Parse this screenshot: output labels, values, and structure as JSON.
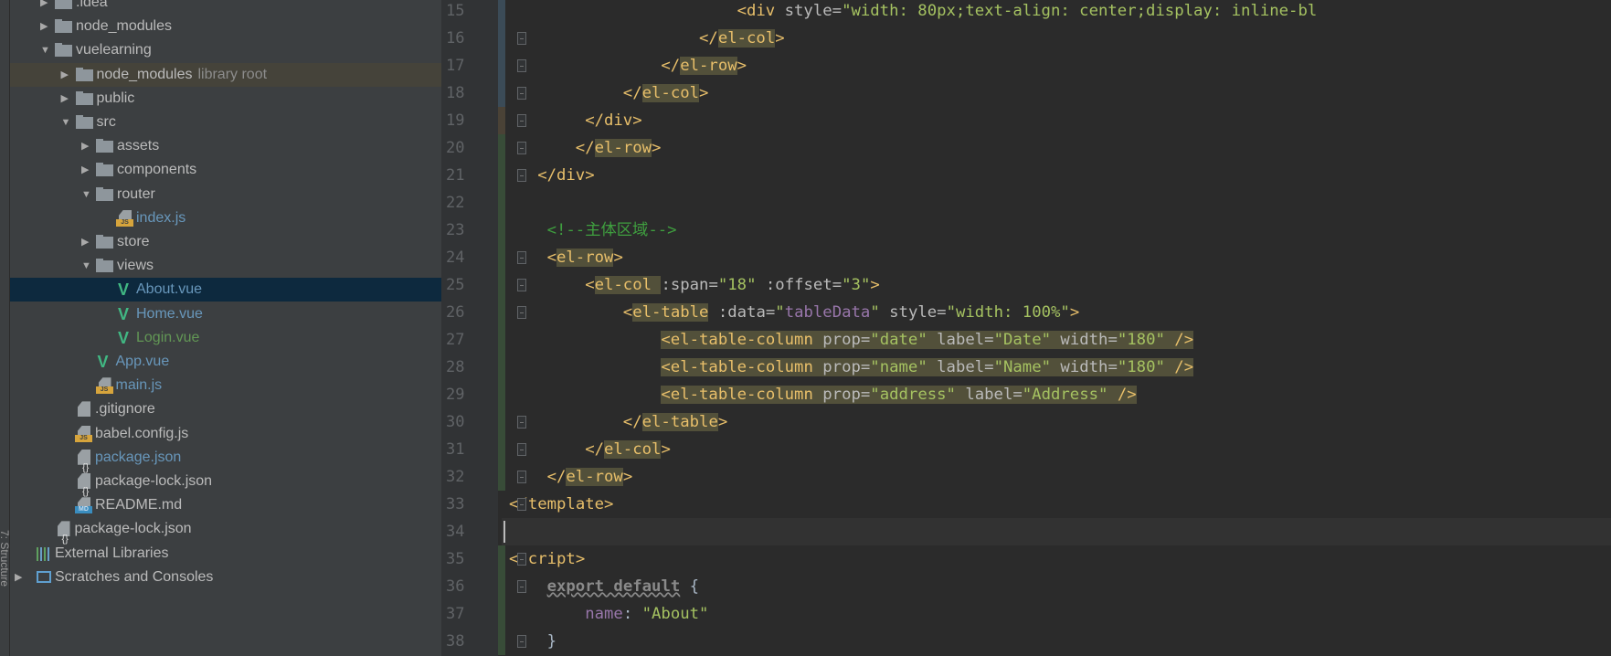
{
  "toolstrip": {
    "structure_label": "7: Structure"
  },
  "project_tree": [
    {
      "label": ".idea",
      "level": 0,
      "kind": "folder",
      "expanded": false
    },
    {
      "label": "node_modules",
      "level": 0,
      "kind": "folder",
      "expanded": false
    },
    {
      "label": "vuelearning",
      "level": 0,
      "kind": "folder",
      "expanded": true
    },
    {
      "label": "node_modules",
      "suffix": "library root",
      "level": 1,
      "kind": "folder",
      "expanded": false,
      "state": "library"
    },
    {
      "label": "public",
      "level": 1,
      "kind": "folder",
      "expanded": false
    },
    {
      "label": "src",
      "level": 1,
      "kind": "folder",
      "expanded": true
    },
    {
      "label": "assets",
      "level": 2,
      "kind": "folder",
      "expanded": false
    },
    {
      "label": "components",
      "level": 2,
      "kind": "folder",
      "expanded": false
    },
    {
      "label": "router",
      "level": 2,
      "kind": "folder",
      "expanded": true
    },
    {
      "label": "index.js",
      "level": 3,
      "kind": "js",
      "color": "#6897bb"
    },
    {
      "label": "store",
      "level": 2,
      "kind": "folder",
      "expanded": false
    },
    {
      "label": "views",
      "level": 2,
      "kind": "folder",
      "expanded": true
    },
    {
      "label": "About.vue",
      "level": 3,
      "kind": "vue",
      "color": "#6897bb",
      "state": "selected"
    },
    {
      "label": "Home.vue",
      "level": 3,
      "kind": "vue",
      "color": "#6897bb"
    },
    {
      "label": "Login.vue",
      "level": 3,
      "kind": "vue",
      "color": "#629755"
    },
    {
      "label": "App.vue",
      "level": 2,
      "kind": "vue",
      "color": "#6897bb"
    },
    {
      "label": "main.js",
      "level": 2,
      "kind": "js",
      "color": "#6897bb"
    },
    {
      "label": ".gitignore",
      "level": 1,
      "kind": "text"
    },
    {
      "label": "babel.config.js",
      "level": 1,
      "kind": "js"
    },
    {
      "label": "package.json",
      "level": 1,
      "kind": "json",
      "color": "#6897bb"
    },
    {
      "label": "package-lock.json",
      "level": 1,
      "kind": "json"
    },
    {
      "label": "README.md",
      "level": 1,
      "kind": "md"
    },
    {
      "label": "package-lock.json",
      "level": 0,
      "kind": "json"
    },
    {
      "label": "External Libraries",
      "level": -1,
      "kind": "libs"
    },
    {
      "label": "Scratches and Consoles",
      "level": -1,
      "kind": "scratches",
      "expanded": false
    }
  ],
  "editor": {
    "current_line": 34,
    "lines": [
      {
        "n": 15,
        "indent": 24,
        "tokens": [
          [
            "<",
            "br"
          ],
          [
            "div",
            "tn"
          ],
          [
            " style=",
            "at"
          ],
          [
            "\"width: 80px;text-align: center;display: inline-bl",
            "st"
          ]
        ]
      },
      {
        "n": 16,
        "indent": 20,
        "tokens": [
          [
            "</",
            "br"
          ],
          [
            "el-col",
            "tg"
          ],
          [
            ">",
            "br"
          ]
        ]
      },
      {
        "n": 17,
        "indent": 16,
        "tokens": [
          [
            "</",
            "br"
          ],
          [
            "el-row",
            "tg"
          ],
          [
            ">",
            "br"
          ]
        ]
      },
      {
        "n": 18,
        "indent": 12,
        "tokens": [
          [
            "</",
            "br"
          ],
          [
            "el-col",
            "tg"
          ],
          [
            ">",
            "br"
          ]
        ]
      },
      {
        "n": 19,
        "indent": 8,
        "tokens": [
          [
            "</",
            "br"
          ],
          [
            "div",
            "tn"
          ],
          [
            ">",
            "br"
          ]
        ]
      },
      {
        "n": 20,
        "indent": 7,
        "tokens": [
          [
            "</",
            "br"
          ],
          [
            "el-row",
            "tg"
          ],
          [
            ">",
            "br"
          ]
        ]
      },
      {
        "n": 21,
        "indent": 3,
        "tokens": [
          [
            "</",
            "br"
          ],
          [
            "div",
            "tn"
          ],
          [
            ">",
            "br"
          ]
        ]
      },
      {
        "n": 22,
        "indent": 0,
        "tokens": []
      },
      {
        "n": 23,
        "indent": 4,
        "tokens": [
          [
            "<!--主体区域-->",
            "cm"
          ]
        ]
      },
      {
        "n": 24,
        "indent": 4,
        "tokens": [
          [
            "<",
            "br"
          ],
          [
            "el-row",
            "tg"
          ],
          [
            ">",
            "br"
          ]
        ]
      },
      {
        "n": 25,
        "indent": 8,
        "tokens": [
          [
            "<",
            "br"
          ],
          [
            "el-col ",
            "tg"
          ],
          [
            ":span=",
            "at"
          ],
          [
            "\"18\"",
            "st"
          ],
          [
            " :offset=",
            "at"
          ],
          [
            "\"3\"",
            "st"
          ],
          [
            ">",
            "br"
          ]
        ]
      },
      {
        "n": 26,
        "indent": 12,
        "tokens": [
          [
            "<",
            "br"
          ],
          [
            "el-table",
            "tg"
          ],
          [
            " :data=",
            "at"
          ],
          [
            "\"",
            "st"
          ],
          [
            "tableData",
            "pu"
          ],
          [
            "\"",
            "st"
          ],
          [
            " style=",
            "at"
          ],
          [
            "\"width: 100%\"",
            "st"
          ],
          [
            ">",
            "br"
          ]
        ]
      },
      {
        "n": 27,
        "indent": 16,
        "highlight": true,
        "tokens": [
          [
            "<el-table-column",
            "tn"
          ],
          [
            " prop=",
            "at"
          ],
          [
            "\"date\"",
            "st"
          ],
          [
            " label=",
            "at"
          ],
          [
            "\"Date\"",
            "st"
          ],
          [
            " width=",
            "at"
          ],
          [
            "\"180\"",
            "st"
          ],
          [
            " />",
            "br"
          ]
        ]
      },
      {
        "n": 28,
        "indent": 16,
        "highlight": true,
        "tokens": [
          [
            "<el-table-column",
            "tn"
          ],
          [
            " prop=",
            "at"
          ],
          [
            "\"name\"",
            "st"
          ],
          [
            " label=",
            "at"
          ],
          [
            "\"Name\"",
            "st"
          ],
          [
            " width=",
            "at"
          ],
          [
            "\"180\"",
            "st"
          ],
          [
            " />",
            "br"
          ]
        ]
      },
      {
        "n": 29,
        "indent": 16,
        "highlight": true,
        "tokens": [
          [
            "<el-table-column",
            "tn"
          ],
          [
            " prop=",
            "at"
          ],
          [
            "\"address\"",
            "st"
          ],
          [
            " label=",
            "at"
          ],
          [
            "\"Address\"",
            "st"
          ],
          [
            " />",
            "br"
          ]
        ]
      },
      {
        "n": 30,
        "indent": 12,
        "tokens": [
          [
            "</",
            "br"
          ],
          [
            "el-table",
            "tg"
          ],
          [
            ">",
            "br"
          ]
        ]
      },
      {
        "n": 31,
        "indent": 8,
        "tokens": [
          [
            "</",
            "br"
          ],
          [
            "el-col",
            "tg"
          ],
          [
            ">",
            "br"
          ]
        ]
      },
      {
        "n": 32,
        "indent": 4,
        "tokens": [
          [
            "</",
            "br"
          ],
          [
            "el-row",
            "tg"
          ],
          [
            ">",
            "br"
          ]
        ]
      },
      {
        "n": 33,
        "indent": 0,
        "tokens": [
          [
            "</",
            "br"
          ],
          [
            "template",
            "tn"
          ],
          [
            ">",
            "br"
          ]
        ]
      },
      {
        "n": 34,
        "indent": 0,
        "tokens": []
      },
      {
        "n": 35,
        "indent": 0,
        "tokens": [
          [
            "<",
            "br"
          ],
          [
            "script",
            "tn"
          ],
          [
            ">",
            "br"
          ]
        ]
      },
      {
        "n": 36,
        "indent": 4,
        "tokens": [
          [
            "export default",
            "kw"
          ],
          [
            " {",
            "pl"
          ]
        ]
      },
      {
        "n": 37,
        "indent": 8,
        "tokens": [
          [
            "name",
            "pu"
          ],
          [
            ": ",
            "pl"
          ],
          [
            "\"About\"",
            "st"
          ]
        ]
      },
      {
        "n": 38,
        "indent": 4,
        "tokens": [
          [
            "}",
            "pl"
          ]
        ]
      }
    ],
    "fold_markers": [
      16,
      17,
      18,
      19,
      20,
      21,
      24,
      25,
      26,
      30,
      31,
      32,
      33,
      35,
      36,
      38
    ]
  },
  "colors": {
    "vcs_modified": "#3b4b57",
    "vcs_changed": "#4a4236",
    "vcs_added": "#384c38"
  }
}
